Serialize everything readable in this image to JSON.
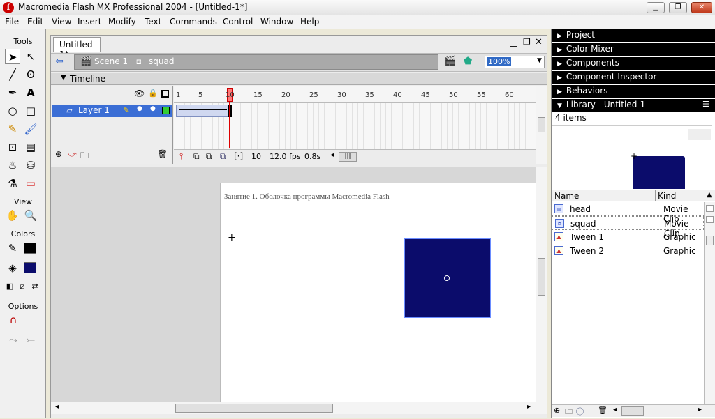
{
  "window": {
    "title": "Macromedia Flash MX Professional 2004 - [Untitled-1*]",
    "app_icon": "flash-icon"
  },
  "menu": [
    "File",
    "Edit",
    "View",
    "Insert",
    "Modify",
    "Text",
    "Commands",
    "Control",
    "Window",
    "Help"
  ],
  "tools": {
    "label": "Tools",
    "view_label": "View",
    "colors_label": "Colors",
    "options_label": "Options"
  },
  "document": {
    "tab": "Untitled-1*",
    "scene": "Scene 1",
    "symbol": "squad",
    "zoom": "100%"
  },
  "timeline": {
    "label": "Timeline",
    "layer": "Layer 1",
    "frame_numbers": [
      "1",
      "5",
      "10",
      "15",
      "20",
      "25",
      "30",
      "35",
      "40",
      "45",
      "50",
      "55",
      "60"
    ],
    "current_frame": "10",
    "fps": "12.0 fps",
    "elapsed": "0.8s"
  },
  "stage": {
    "page_text": "Занятие 1. Оболочка программы Macromedia Flash",
    "square_color": "#0b0c6b"
  },
  "panels": {
    "project": "Project",
    "color_mixer": "Color Mixer",
    "components": "Components",
    "component_inspector": "Component Inspector",
    "behaviors": "Behaviors",
    "library": "Library - Untitled-1"
  },
  "library": {
    "count": "4 items",
    "col_name": "Name",
    "col_kind": "Kind",
    "items": [
      {
        "name": "head",
        "kind": "Movie Clip"
      },
      {
        "name": "squad",
        "kind": "Movie Clip"
      },
      {
        "name": "Tween 1",
        "kind": "Graphic"
      },
      {
        "name": "Tween 2",
        "kind": "Graphic"
      }
    ]
  }
}
